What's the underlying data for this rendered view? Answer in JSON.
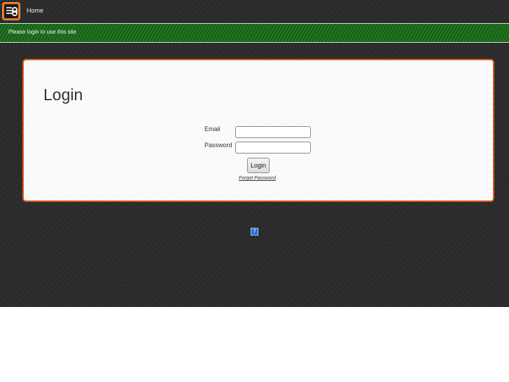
{
  "header": {
    "nav": {
      "home_label": "Home"
    }
  },
  "notice": {
    "text": "Please login to use this site"
  },
  "login": {
    "title": "Login",
    "email_label": "Email",
    "email_value": "",
    "password_label": "Password",
    "password_value": "",
    "submit_label": "Login",
    "forgot_label": "Forgot Password"
  },
  "footer": {
    "help_glyph": "?"
  },
  "colors": {
    "accent_orange": "#e05a1a",
    "notice_green": "#1f6b1f",
    "background_dark": "#2b2b2b",
    "help_blue": "#1f6fd1"
  }
}
